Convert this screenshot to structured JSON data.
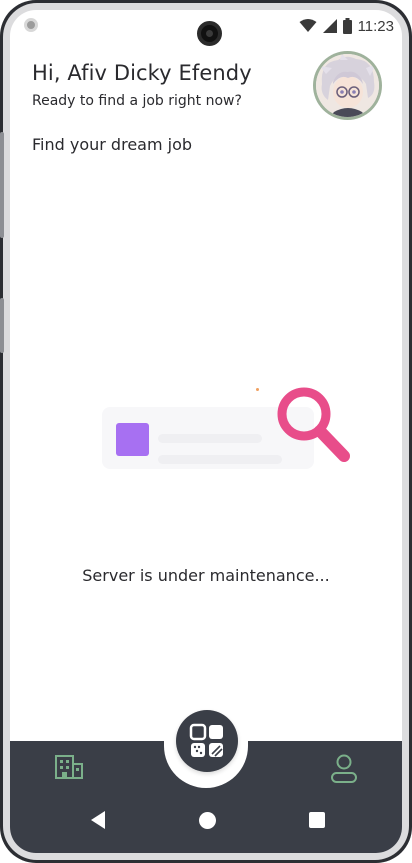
{
  "status_bar": {
    "time": "11:23",
    "icons": [
      "wifi-icon",
      "signal-icon",
      "battery-icon"
    ]
  },
  "header": {
    "greeting": "Hi, Afiv Dicky Efendy",
    "subtitle": "Ready to find a job right now?"
  },
  "section_title": "Find your dream job",
  "empty_state": {
    "message": "Server is under maintenance..."
  },
  "bottom_nav": {
    "left_icon": "building-icon",
    "center_icon": "dashboard-icon",
    "right_icon": "profile-icon"
  },
  "colors": {
    "nav_bg": "#3a3e47",
    "accent_green": "#7bb08a",
    "magnifier_pink": "#e84d8a",
    "card_purple": "#a770f2"
  }
}
